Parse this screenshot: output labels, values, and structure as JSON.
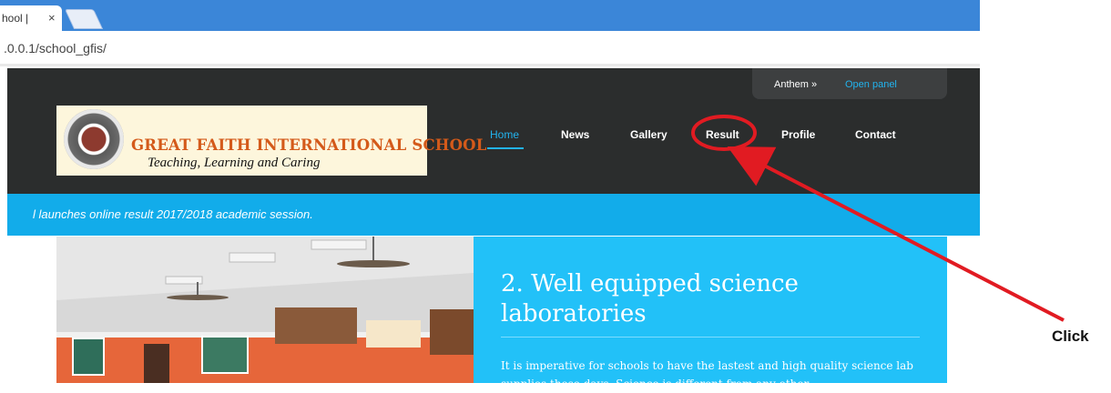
{
  "browser": {
    "tab_title": "hool |",
    "tab_close": "×",
    "url": ".0.0.1/school_gfis/"
  },
  "header": {
    "panel_label": "Anthem »",
    "panel_link": "Open panel",
    "logo": {
      "school_name": "GREAT FAITH INTERNATIONAL SCHOOL",
      "motto": "Teaching, Learning and Caring"
    },
    "nav": [
      "Home",
      "News",
      "Gallery",
      "Result",
      "Profile",
      "Contact"
    ]
  },
  "ticker": {
    "text": "l launches online result 2017/2018 academic session."
  },
  "slide": {
    "heading": "2. Well equipped science laboratories",
    "body": "It is imperative for schools to have the lastest and high quality science lab supplies these days. Science is different from any other"
  },
  "annotation": {
    "label": "Click",
    "color": "#e11b22"
  },
  "colors": {
    "accent": "#22b3ee",
    "header_bg": "#2b2d2d",
    "ticker_bg": "#12acea",
    "slide_bg": "#22c1f8"
  }
}
